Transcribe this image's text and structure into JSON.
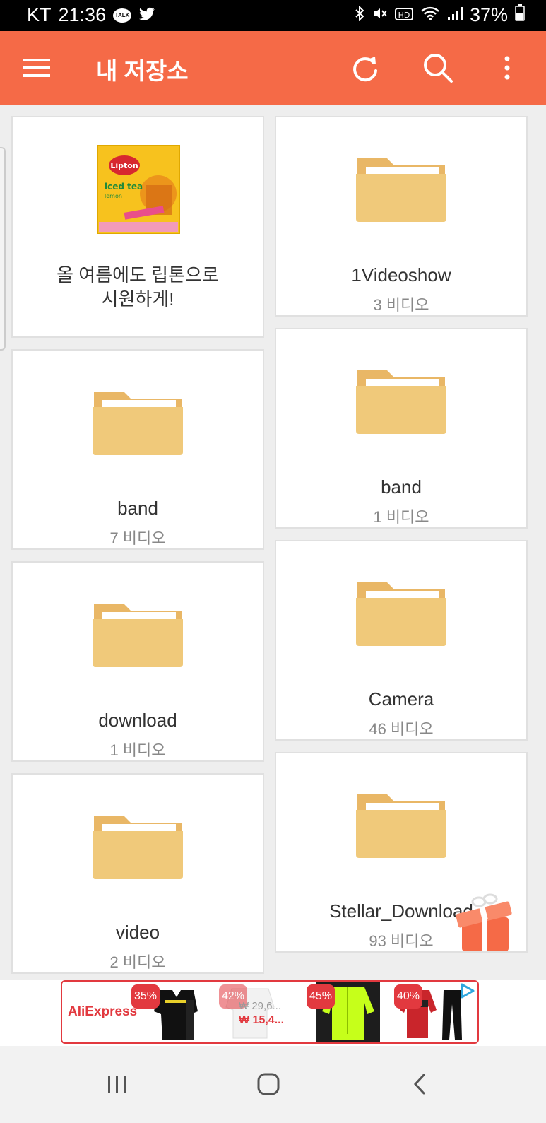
{
  "status_bar": {
    "carrier": "KT",
    "time": "21:36",
    "battery": "37%",
    "talk_icon_text": "TALK"
  },
  "app_bar": {
    "title": "내 저장소",
    "icons": [
      "menu-icon",
      "refresh-icon",
      "search-icon",
      "more-vert-icon"
    ]
  },
  "ad_card": {
    "title_line1": "올 여름에도 립톤으로",
    "title_line2": "시원하게!",
    "image": "lipton-iced-tea-box"
  },
  "folders": [
    {
      "name": "1Videoshow",
      "count": "3 비디오"
    },
    {
      "name": "band",
      "count": "7 비디오"
    },
    {
      "name": "band",
      "count": "1 비디오"
    },
    {
      "name": "download",
      "count": "1 비디오"
    },
    {
      "name": "Camera",
      "count": "46 비디오"
    },
    {
      "name": "video",
      "count": "2 비디오"
    },
    {
      "name": "Stellar_Download",
      "count": "93 비디오"
    }
  ],
  "banner_ad": {
    "brand": "AliExpress",
    "badges": [
      "35%",
      "42%",
      "45%",
      "40%"
    ],
    "old_price": "₩ 29,6...",
    "new_price": "₩ 15,4..."
  },
  "colors": {
    "accent": "#f56a47",
    "folder": "#f0c97a",
    "folder_tab": "#e9b766",
    "ad_red": "#e2393f"
  }
}
